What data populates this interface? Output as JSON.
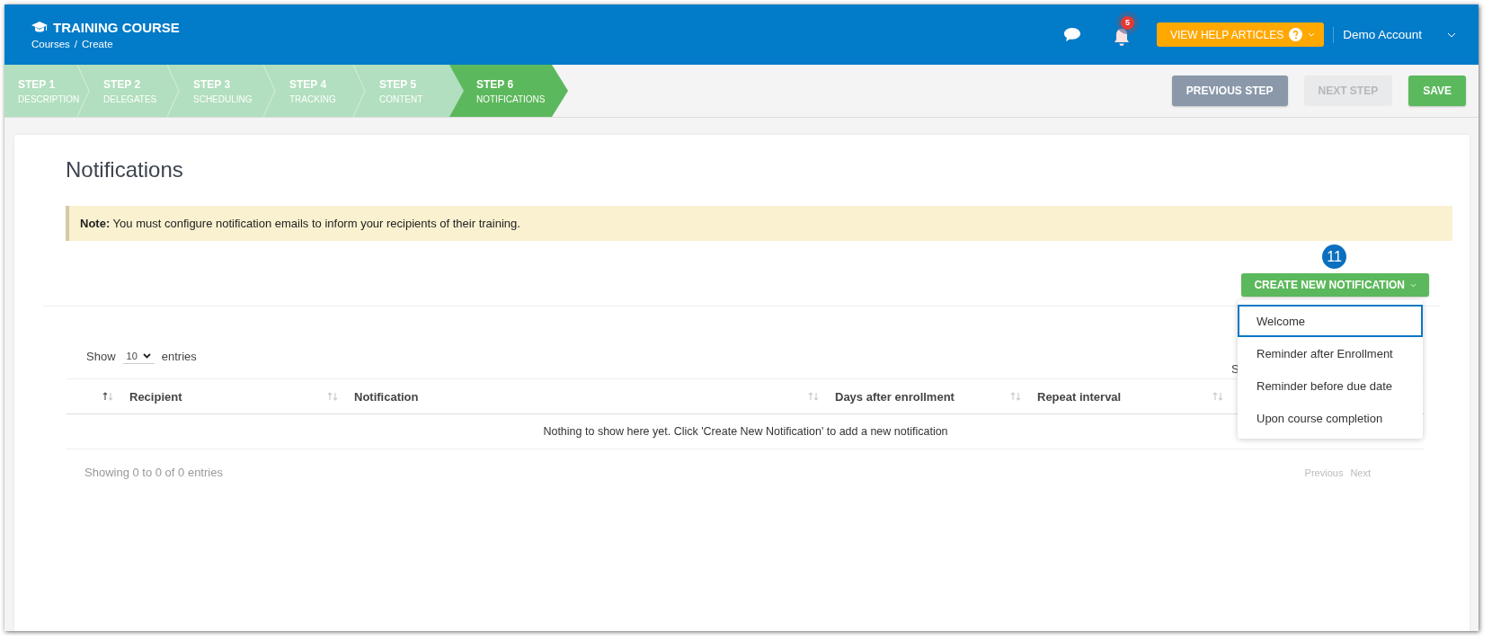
{
  "header": {
    "title": "TRAINING COURSE",
    "breadcrumb": [
      "Courses",
      "Create"
    ],
    "breadcrumb_separator": "/",
    "notification_count": "5",
    "help_button": "VIEW HELP ARTICLES",
    "account": "Demo Account"
  },
  "steps": [
    {
      "number": "STEP 1",
      "label": "DESCRIPTION",
      "selected": false
    },
    {
      "number": "STEP 2",
      "label": "DELEGATES",
      "selected": false
    },
    {
      "number": "STEP 3",
      "label": "SCHEDULING",
      "selected": false
    },
    {
      "number": "STEP 4",
      "label": "TRACKING",
      "selected": false
    },
    {
      "number": "STEP 5",
      "label": "CONTENT",
      "selected": false
    },
    {
      "number": "STEP 6",
      "label": "NOTIFICATIONS",
      "selected": true
    }
  ],
  "step_buttons": [
    {
      "label": "PREVIOUS STEP",
      "kind": "secondary",
      "disabled": false
    },
    {
      "label": "NEXT STEP",
      "kind": "secondary",
      "disabled": true
    },
    {
      "label": "SAVE",
      "kind": "primary",
      "disabled": false
    }
  ],
  "page": {
    "title": "Notifications",
    "note": "**Note:** You must configure notification emails to inform your recipients of their training.",
    "callout": "11",
    "create_button": "CREATE NEW NOTIFICATION",
    "create_menu": [
      {
        "label": "Welcome",
        "selected": true
      },
      {
        "label": "Reminder after Enrollment",
        "selected": false
      },
      {
        "label": "Reminder before due date",
        "selected": false
      },
      {
        "label": "Upon course completion",
        "selected": false
      }
    ],
    "table": {
      "show_label": "Show",
      "page_size": "10",
      "entries_label": "entries",
      "search_label": "S",
      "columns": [
        {
          "sorted": true
        },
        {
          "label": "Recipient",
          "sorted": false
        },
        {
          "label": "Notification",
          "sorted": false
        },
        {
          "label": "Days after enrollment",
          "sorted": false
        },
        {
          "label": "Repeat interval",
          "sorted": false
        }
      ],
      "empty_message": "Nothing to show here yet. Click 'Create New Notification' to add a new notification",
      "info": "Showing 0 to 0 of 0 entries",
      "pager": [
        {
          "label": "Previous",
          "disabled": true
        },
        {
          "label": "Next",
          "disabled": true
        }
      ]
    }
  }
}
